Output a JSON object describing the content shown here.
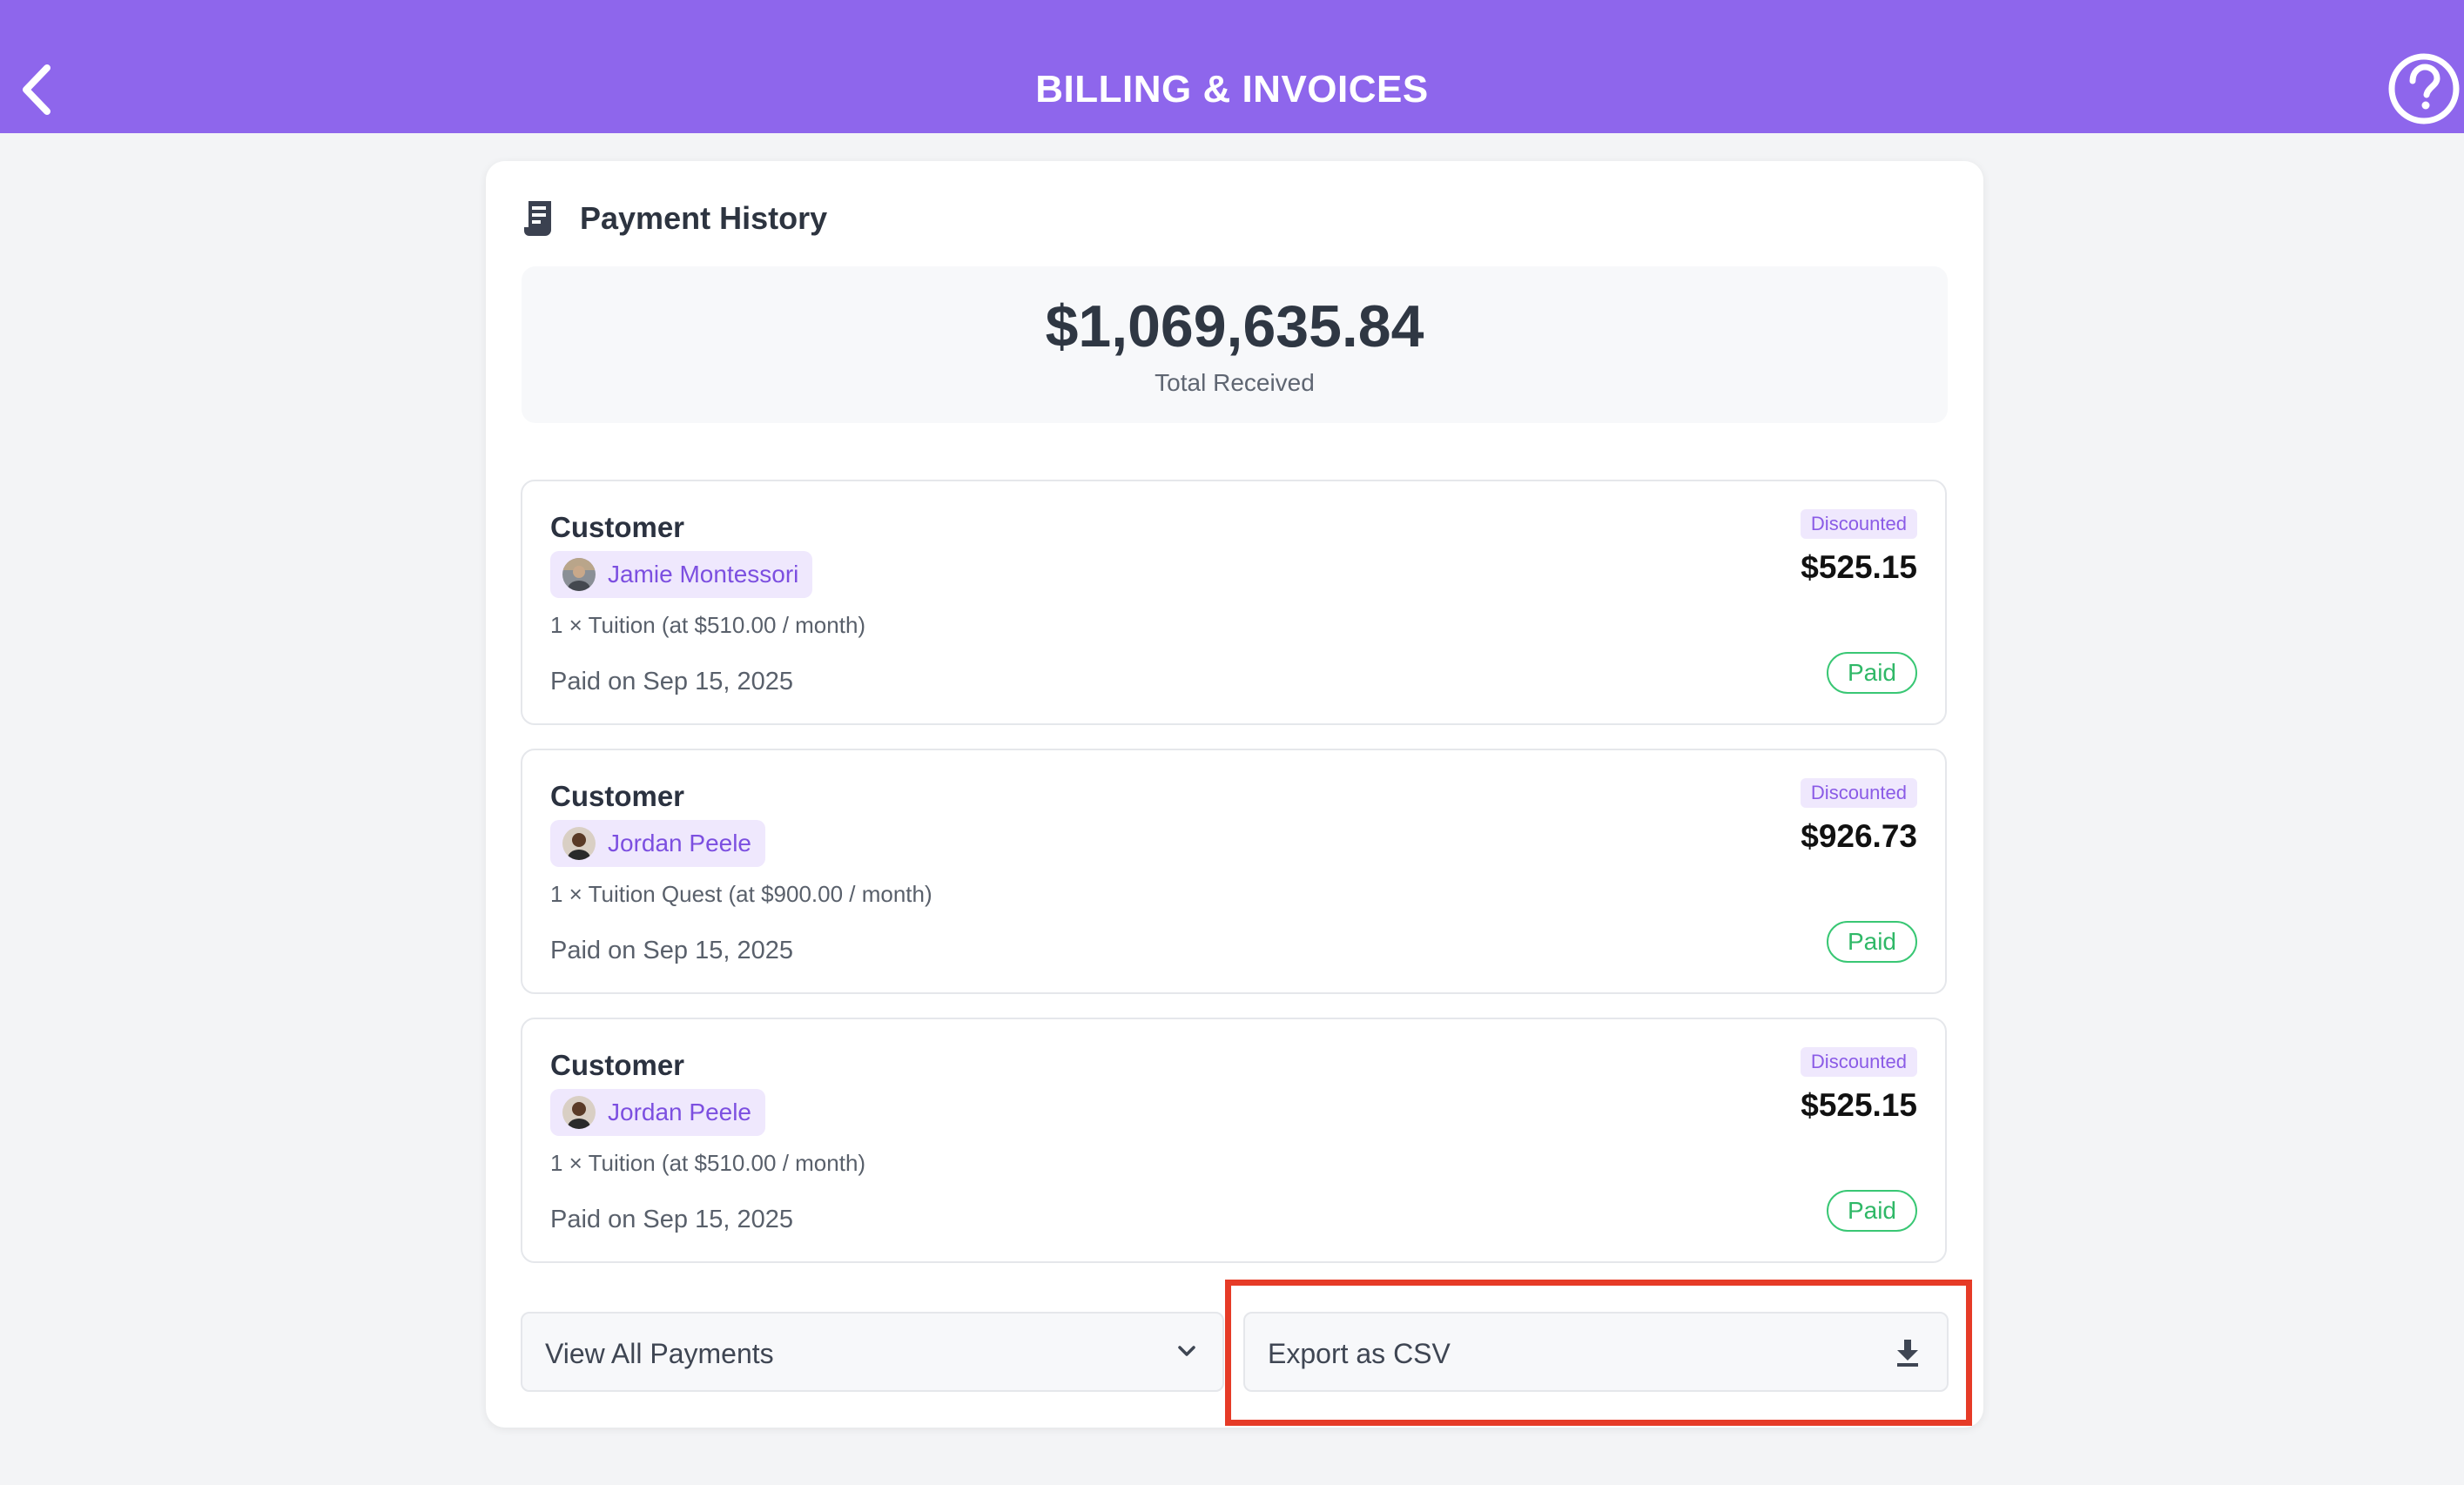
{
  "header": {
    "title": "BILLING & INVOICES",
    "back_icon": "chevron-left-icon",
    "help_icon": "question-circle-icon",
    "background": "#8e66ec"
  },
  "payment_history": {
    "title": "Payment History",
    "icon": "receipt-icon",
    "total_amount": "$1,069,635.84",
    "total_label": "Total Received"
  },
  "payments": [
    {
      "customer_label": "Customer",
      "customer_name": "Jamie Montessori",
      "line_item": "1 × Tuition (at $510.00 / month)",
      "paid_on": "Paid on Sep 15, 2025",
      "discount_badge": "Discounted",
      "amount": "$525.15",
      "status": "Paid"
    },
    {
      "customer_label": "Customer",
      "customer_name": "Jordan Peele",
      "line_item": "1 × Tuition Quest (at $900.00 / month)",
      "paid_on": "Paid on Sep 15, 2025",
      "discount_badge": "Discounted",
      "amount": "$926.73",
      "status": "Paid"
    },
    {
      "customer_label": "Customer",
      "customer_name": "Jordan Peele",
      "line_item": "1 × Tuition (at $510.00 / month)",
      "paid_on": "Paid on Sep 15, 2025",
      "discount_badge": "Discounted",
      "amount": "$525.15",
      "status": "Paid"
    }
  ],
  "actions": {
    "view_all_label": "View All Payments",
    "view_all_icon": "chevron-down-icon",
    "export_label": "Export as CSV",
    "export_icon": "download-icon"
  },
  "colors": {
    "accent": "#8e66ec",
    "paid": "#2fb867",
    "highlight": "#e63b27"
  }
}
